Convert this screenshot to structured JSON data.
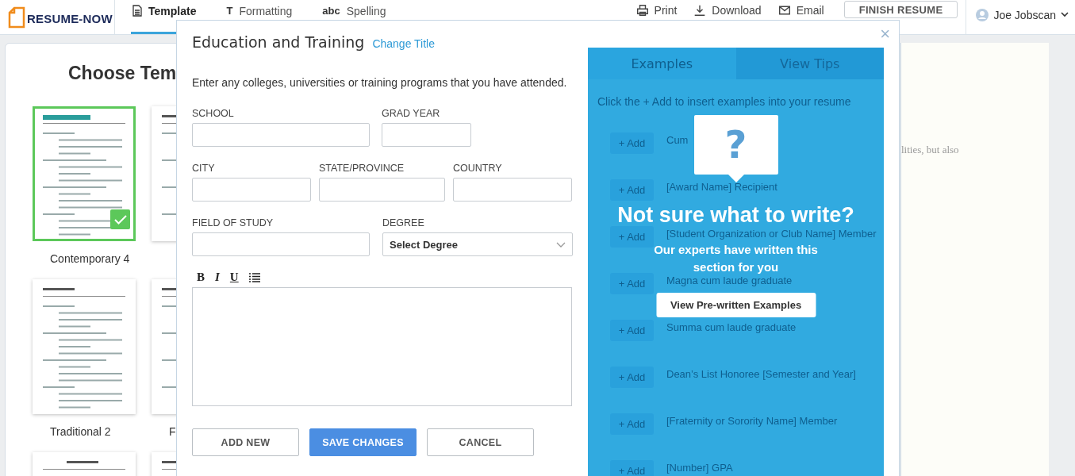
{
  "brand": {
    "name": "RESUME-NOW"
  },
  "nav_tabs": [
    {
      "label": "Template",
      "kind": "document",
      "selected": true
    },
    {
      "label": "Formatting",
      "kind": "glyph",
      "icon_text": "T",
      "selected": false
    },
    {
      "label": "Spelling",
      "kind": "glyph",
      "icon_text": "abc",
      "selected": false
    }
  ],
  "actions": [
    {
      "label": "Print",
      "kind": "print"
    },
    {
      "label": "Download",
      "kind": "download"
    },
    {
      "label": "Email",
      "kind": "email"
    }
  ],
  "finish_button": "FINISH RESUME",
  "user": {
    "name": "Joe Jobscan"
  },
  "template_panel": {
    "title": "Choose Tem",
    "templates": [
      {
        "label": "Contemporary 4",
        "selected": true,
        "kind": "accent"
      },
      {
        "selected": false,
        "kind": "plain"
      },
      {
        "label": "Traditional 2",
        "selected": false,
        "kind": "plain"
      },
      {
        "label": "F",
        "selected": false,
        "kind": "plain"
      },
      {
        "selected": false,
        "kind": "centered"
      },
      {
        "selected": false,
        "kind": "plain"
      }
    ]
  },
  "resume_preview": {
    "text": "lities, but also"
  },
  "modal": {
    "title": "Education and Training",
    "change_title": "Change Title",
    "close": "×",
    "intro": "Enter any colleges, universities or training programs that you have attended.",
    "field_rows": [
      [
        {
          "label": "SCHOOL",
          "kind": "input"
        },
        {
          "label": "GRAD YEAR",
          "kind": "input"
        }
      ],
      [
        {
          "label": "CITY",
          "kind": "input"
        },
        {
          "label": "STATE/PROVINCE",
          "kind": "input"
        },
        {
          "label": "COUNTRY",
          "kind": "input"
        }
      ],
      [
        {
          "label": "FIELD OF STUDY",
          "kind": "input"
        },
        {
          "label": "DEGREE",
          "kind": "select",
          "value": "Select Degree"
        }
      ]
    ],
    "editor_tools": [
      {
        "label": "B",
        "kind": "bold"
      },
      {
        "label": "I",
        "kind": "italic"
      },
      {
        "label": "U",
        "kind": "underline"
      },
      {
        "kind": "list"
      }
    ],
    "buttons": [
      {
        "label": "ADD NEW",
        "kind": "secondary"
      },
      {
        "label": "SAVE CHANGES",
        "kind": "primary"
      },
      {
        "label": "CANCEL",
        "kind": "secondary"
      }
    ],
    "examples_panel": {
      "tabs": [
        {
          "label": "Examples",
          "selected": true
        },
        {
          "label": "View Tips",
          "selected": false
        }
      ],
      "hint": "Click the + Add to insert examples into your resume",
      "items": [
        {
          "add": "+ Add",
          "text": "Cum"
        },
        {
          "add": "+ Add",
          "text": "[Award Name] Recipient"
        },
        {
          "add": "+ Add",
          "text": "[Student Organization or Club Name] Member"
        },
        {
          "add": "+ Add",
          "text": "Magna cum laude graduate"
        },
        {
          "add": "+ Add",
          "text": "Summa cum laude graduate"
        },
        {
          "add": "+ Add",
          "text": "Dean’s List Honoree [Semester and Year]"
        },
        {
          "add": "+ Add",
          "text": "[Fraternity or Sorority Name] Member"
        },
        {
          "add": "+ Add",
          "text": "[Number] GPA"
        }
      ],
      "overlay": {
        "icon": "?",
        "heading": "Not sure what to write?",
        "text": "Our experts have written this section for you",
        "button": "View Pre-written Examples"
      }
    }
  }
}
